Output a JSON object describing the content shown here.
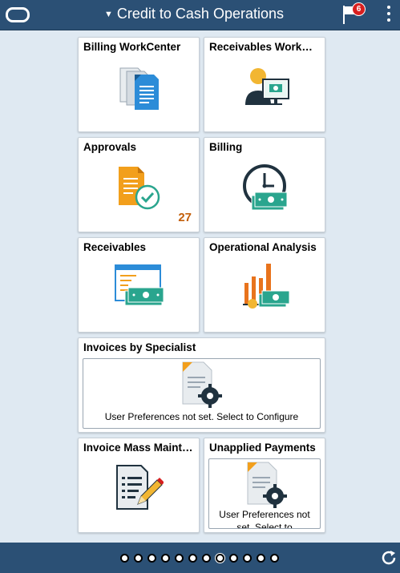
{
  "header": {
    "title": "Credit to Cash Operations",
    "notification_count": "6"
  },
  "tiles": [
    {
      "title": "Billing WorkCenter"
    },
    {
      "title": "Receivables WorkCenter"
    },
    {
      "title": "Approvals",
      "count": "27"
    },
    {
      "title": "Billing"
    },
    {
      "title": "Receivables"
    },
    {
      "title": "Operational Analysis"
    },
    {
      "title": "Invoices by Specialist",
      "message": "User Preferences not set. Select to Configure"
    },
    {
      "title": "Invoice Mass Maintenance"
    },
    {
      "title": "Unapplied Payments",
      "message_line1": "User Preferences not",
      "message_line2": "set. Select to"
    }
  ],
  "pagination": {
    "pages": 12,
    "active_index": 7
  },
  "colors": {
    "header_bg": "#2b5075",
    "page_bg": "#dfe9f2",
    "badge": "#d81f1f",
    "count": "#c35f0a"
  }
}
